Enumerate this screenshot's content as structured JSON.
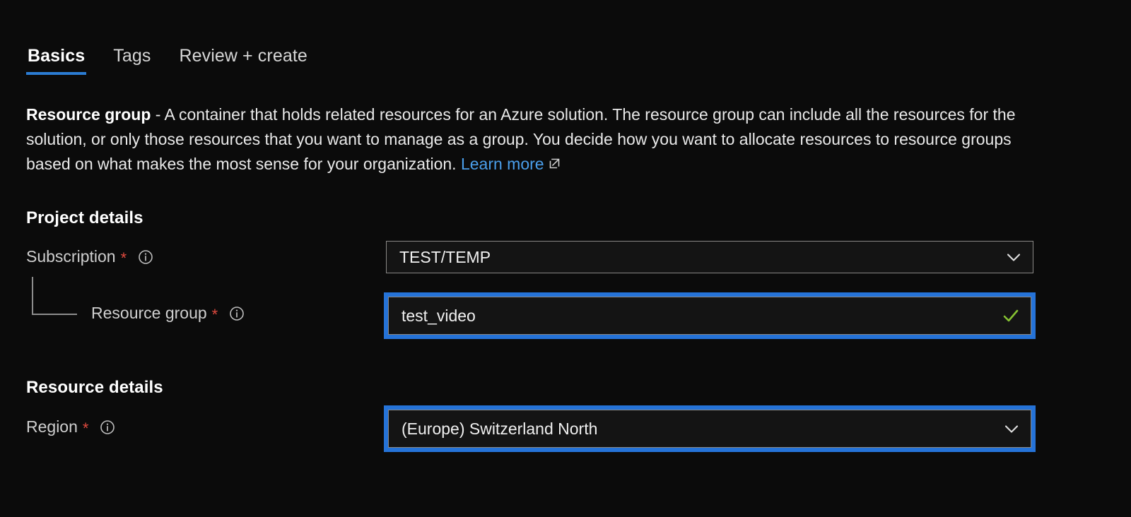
{
  "tabs": [
    {
      "label": "Basics",
      "active": true
    },
    {
      "label": "Tags",
      "active": false
    },
    {
      "label": "Review + create",
      "active": false
    }
  ],
  "description": {
    "lead": "Resource group",
    "body": " - A container that holds related resources for an Azure solution. The resource group can include all the resources for the solution, or only those resources that you want to manage as a group. You decide how you want to allocate resources to resource groups based on what makes the most sense for your organization. ",
    "link_label": "Learn more",
    "link_icon": "external-link-icon"
  },
  "project_details": {
    "heading": "Project details",
    "subscription": {
      "label": "Subscription",
      "required_marker": "*",
      "info_icon": "info-icon",
      "value": "TEST/TEMP",
      "chevron_icon": "chevron-down-icon",
      "highlighted": false
    },
    "resource_group": {
      "label": "Resource group",
      "required_marker": "*",
      "info_icon": "info-icon",
      "value": "test_video",
      "status_icon": "check-icon",
      "highlighted": true
    }
  },
  "resource_details": {
    "heading": "Resource details",
    "region": {
      "label": "Region",
      "required_marker": "*",
      "info_icon": "info-icon",
      "value": "(Europe) Switzerland North",
      "chevron_icon": "chevron-down-icon",
      "highlighted": true
    }
  },
  "colors": {
    "background": "#0b0b0b",
    "accent_blue": "#2b7cd3",
    "highlight_blue": "#2573d8",
    "link_blue": "#4a9eea",
    "required_red": "#e04a3f",
    "success_green": "#86c232",
    "field_border": "#8a8886"
  }
}
